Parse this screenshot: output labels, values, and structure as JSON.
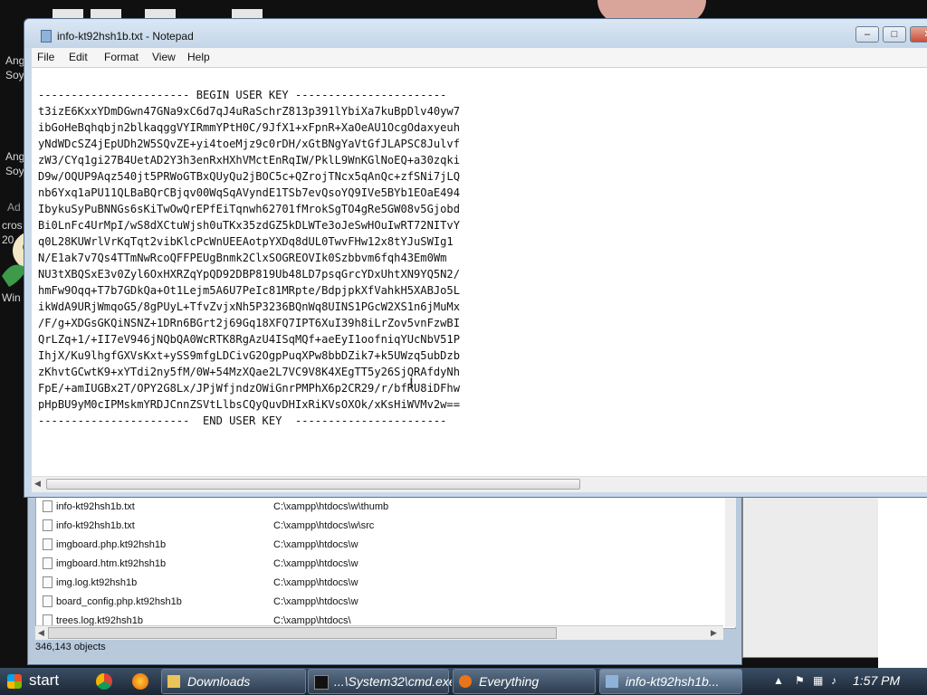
{
  "desktop": {
    "icon_labels": [
      {
        "name": "Ang",
        "sub": "Soy"
      },
      {
        "name": "Ang",
        "sub": "Soy"
      }
    ],
    "partial_labels": [
      "Ad",
      "cros",
      "20",
      "Win"
    ]
  },
  "notepad": {
    "title": "info-kt92hsh1b.txt - Notepad",
    "menu": [
      "File",
      "Edit",
      "Format",
      "View",
      "Help"
    ],
    "content": [
      "----------------------- BEGIN USER KEY -----------------------",
      "t3izE6KxxYDmDGwn47GNa9xC6d7qJ4uRaSchrZ813p391lYbiXa7kuBpDlv40yw7",
      "ibGoHeBqhqbjn2blkaqggVYIRmmYPtH0C/9JfX1+xFpnR+XaOeAU1OcgOdaxyeuh",
      "yNdWDcSZ4jEpUDh2W5SQvZE+yi4toeMjz9c0rDH/xGtBNgYaVtGfJLAPSC8Julvf",
      "zW3/CYq1gi27B4UetAD2Y3h3enRxHXhVMctEnRqIW/PklL9WnKGlNoEQ+a30zqki",
      "D9w/OQUP9Aqz540jt5PRWoGTBxQUyQu2jBOC5c+QZrojTNcx5qAnQc+zfSNi7jLQ",
      "nb6Yxq1aPU11QLBaBQrCBjqv00WqSqAVyndE1TSb7evQsoYQ9IVe5BYb1EOaE494",
      "IbykuSyPuBNNGs6sKiTwOwQrEPfEiTqnwh62701fMrokSgTO4gRe5GW08v5Gjobd",
      "Bi0LnFc4UrMpI/wS8dXCtuWjsh0uTKx35zdGZ5kDLWTe3oJeSwHOuIwRT72NITvY",
      "q0L28KUWrlVrKqTqt2vibKlcPcWnUEEAotpYXDq8dUL0TwvFHw12x8tYJuSWIg1",
      "N/E1ak7v7Qs4TTmNwRcoQFFPEUgBnmk2ClxSOGREOVIk0Szbbvm6fqh43Em0Wm",
      "NU3tXBQSxE3v0Zyl6OxHXRZqYpQD92DBP819Ub48LD7psqGrcYDxUhtXN9YQ5N2/",
      "hmFw9Oqq+T7b7GDkQa+Ot1Lejm5A6U7PeIc81MRpte/BdpjpkXfVahkH5XABJo5L",
      "ikWdA9URjWmqoG5/8gPUyL+TfvZvjxNh5P3236BQnWq8UINS1PGcW2XS1n6jMuMx",
      "/F/g+XDGsGKQiNSNZ+1DRn6BGrt2j69Gq18XFQ7IPT6XuI39h8iLrZov5vnFzwBI",
      "QrLZq+1/+II7eV946jNQbQA0WcRTK8RgAzU4ISqMQf+aeEyI1oofniqYUcNbV51P",
      "IhjX/Ku9lhgfGXVsKxt+ySS9mfgLDCivG2OgpPuqXPw8bbDZik7+k5UWzq5ubDzb",
      "zKhvtGCwtK9+xYTdi2ny5fM/0W+54MzXQae2L7VC9V8K4XEgTT5y26SjQRAfdyNh",
      "FpE/+amIUGBx2T/OPY2G8Lx/JPjWfjndzOWiGnrPMPhX6p2CR29/r/bfRU8iDFhw",
      "pHpBU9yM0cIPMskmYRDJCnnZSVtLlbsCQyQuvDHIxRiKVsOXOk/xKsHiWVMv2w==",
      "-----------------------  END USER KEY  -----------------------"
    ]
  },
  "explorer": {
    "rows": [
      {
        "name": "info-kt92hsh1b.txt",
        "path": "C:\\xampp\\htdocs\\w\\thumb"
      },
      {
        "name": "info-kt92hsh1b.txt",
        "path": "C:\\xampp\\htdocs\\w\\src"
      },
      {
        "name": "imgboard.php.kt92hsh1b",
        "path": "C:\\xampp\\htdocs\\w"
      },
      {
        "name": "imgboard.htm.kt92hsh1b",
        "path": "C:\\xampp\\htdocs\\w"
      },
      {
        "name": "img.log.kt92hsh1b",
        "path": "C:\\xampp\\htdocs\\w"
      },
      {
        "name": "board_config.php.kt92hsh1b",
        "path": "C:\\xampp\\htdocs\\w"
      },
      {
        "name": "trees.log.kt92hsh1b",
        "path": "C:\\xampp\\htdocs\\"
      }
    ],
    "status": "346,143 objects"
  },
  "taskbar": {
    "start_label": "start",
    "tasks": [
      "Downloads",
      "...\\System32\\cmd.exe",
      "Everything",
      "info-kt92hsh1b..."
    ],
    "clock": "1:57 PM"
  }
}
